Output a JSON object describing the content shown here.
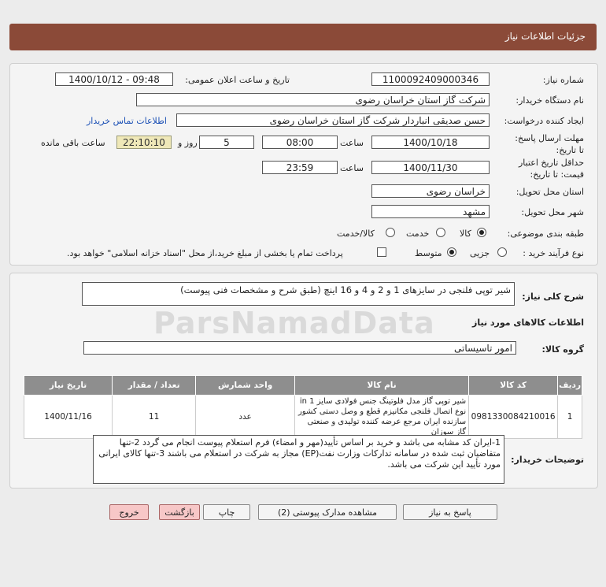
{
  "header": {
    "title": "جزئیات اطلاعات نیاز"
  },
  "fields": {
    "need_number_label": "شماره نیاز:",
    "need_number": "1100092409000346",
    "announce_label": "تاریخ و ساعت اعلان عمومی:",
    "announce_value": "1400/10/12 - 09:48",
    "buyer_org_label": "نام دستگاه خریدار:",
    "buyer_org": "شرکت گاز استان خراسان رضوی",
    "creator_label": "ایجاد کننده درخواست:",
    "creator": "حسن صدیقی انباردار شرکت گاز استان خراسان رضوی",
    "contact_link": "اطلاعات تماس خریدار",
    "deadline_label": "مهلت ارسال پاسخ: تا تاریخ:",
    "deadline_date": "1400/10/18",
    "time_label": "ساعت",
    "deadline_time": "08:00",
    "days_value": "5",
    "days_label": "روز و",
    "remaining_time": "22:10:10",
    "remaining_label": "ساعت باقی مانده",
    "validity_label": "حداقل تاریخ اعتبار قیمت: تا تاریخ:",
    "validity_date": "1400/11/30",
    "validity_time": "23:59",
    "province_label": "استان محل تحویل:",
    "province": "خراسان رضوی",
    "city_label": "شهر محل تحویل:",
    "city": "مشهد",
    "category_label": "طبقه بندی موضوعی:",
    "category_options": [
      "کالا",
      "خدمت",
      "کالا/خدمت"
    ],
    "category_selected": "کالا",
    "process_label": "نوع فرآیند خرید :",
    "process_options": [
      "جزیی",
      "متوسط"
    ],
    "process_selected": "متوسط",
    "payment_note": "پرداخت تمام یا بخشی از مبلغ خرید،از محل \"اسناد خزانه اسلامی\" خواهد بود."
  },
  "summary": {
    "label": "شرح کلی نیاز:",
    "value": "شیر توپی فلنجی در سایزهای 1 و 2 و 4 و 16 اینچ (طبق شرح و مشخصات فنی پیوست)"
  },
  "goods_info_title": "اطلاعات کالاهای مورد نیاز",
  "goods_group": {
    "label": "گروه کالا:",
    "value": "امور تاسیساتی"
  },
  "table": {
    "headers": [
      "ردیف",
      "کد کالا",
      "نام کالا",
      "واحد شمارش",
      "تعداد / مقدار",
      "تاریخ نیاز"
    ],
    "rows": [
      {
        "row": "1",
        "code": "0981330084210016",
        "name": "شیر توپی گاز مدل فلوتینگ جنس فولادی سایز 1 in نوع اتصال فلنجی مکانیزم قطع و وصل دستی کشور سازنده ایران مرجع عرضه کننده تولیدی و صنعتی گاز سوزان",
        "unit": "عدد",
        "qty": "11",
        "date": "1400/11/16"
      }
    ]
  },
  "buyer_notes": {
    "label": "توضیحات خریدار:",
    "value": "1-ایران کد مشابه می باشد و خرید بر اساس تأیید(مهر و امضاء) فرم استعلام پیوست انجام می گردد 2-تنها متقاضیان ثبت شده در سامانه تدارکات وزارت نفت(EP) مجاز به شرکت در استعلام می باشند 3-تنها کالای ایرانی مورد تأیید این شرکت می باشد."
  },
  "buttons": {
    "reply": "پاسخ به نیاز",
    "view_docs": "مشاهده مدارک پیوستی (2)",
    "print": "چاپ",
    "back": "بازگشت",
    "exit": "خروج"
  },
  "watermark": "ParsNamadData",
  "colors": {
    "header_bg": "#8b4a38",
    "table_header_bg": "#8e8e8e",
    "remaining_bg": "#efe8b8",
    "button_red": "#f7c7c7"
  }
}
